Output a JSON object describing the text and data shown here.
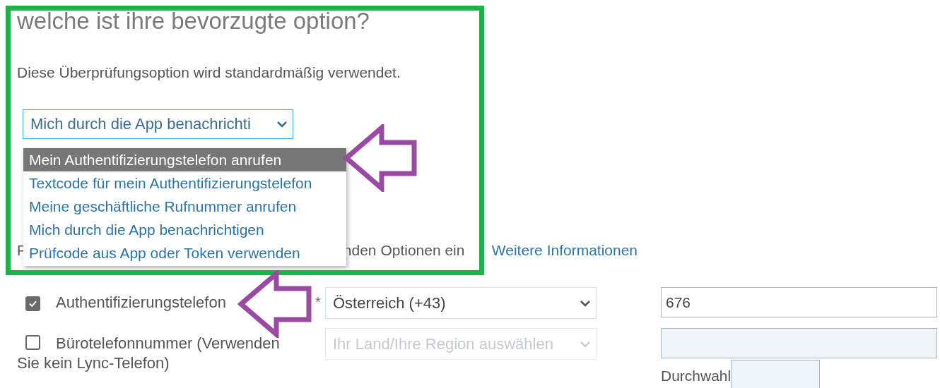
{
  "question": {
    "title": "welche ist ihre bevorzugte option?",
    "description": "Diese Überprüfungsoption wird standardmäßig verwendet.",
    "select": {
      "value": "Mich durch die App benachrichti",
      "expanded": true,
      "options": [
        {
          "label": "Mein Authentifizierungstelefon anrufen",
          "selected": true
        },
        {
          "label": "Textcode für mein Authentifizierungstelefon",
          "selected": false
        },
        {
          "label": "Meine geschäftliche Rufnummer anrufen",
          "selected": false
        },
        {
          "label": "Mich durch die App benachrichtigen",
          "selected": false
        },
        {
          "label": "Prüfcode aus App oder Token verwenden",
          "selected": false
        }
      ]
    }
  },
  "covered_text": {
    "line_2_start": "F",
    "line_2_end": "nden Optionen ein",
    "link": "Weitere Informationen"
  },
  "methods": [
    {
      "label": "Authentifizierungstelefon",
      "checked": true,
      "required_mark": "*",
      "country": {
        "value": "Österreich (+43)",
        "disabled": false
      },
      "phone": {
        "value": "676",
        "disabled": false
      }
    },
    {
      "label": "Bürotelefonnummer (Verwenden Sie kein Lync-Telefon)",
      "checked": false,
      "country": {
        "placeholder": "Ihr Land/Ihre Region auswählen",
        "disabled": true
      },
      "phone": {
        "disabled": true
      },
      "extension": {
        "label": "Durchwahl",
        "disabled": true
      }
    }
  ],
  "annotations": [
    {
      "kind": "frame"
    },
    {
      "kind": "arrow"
    },
    {
      "kind": "arrow"
    }
  ]
}
